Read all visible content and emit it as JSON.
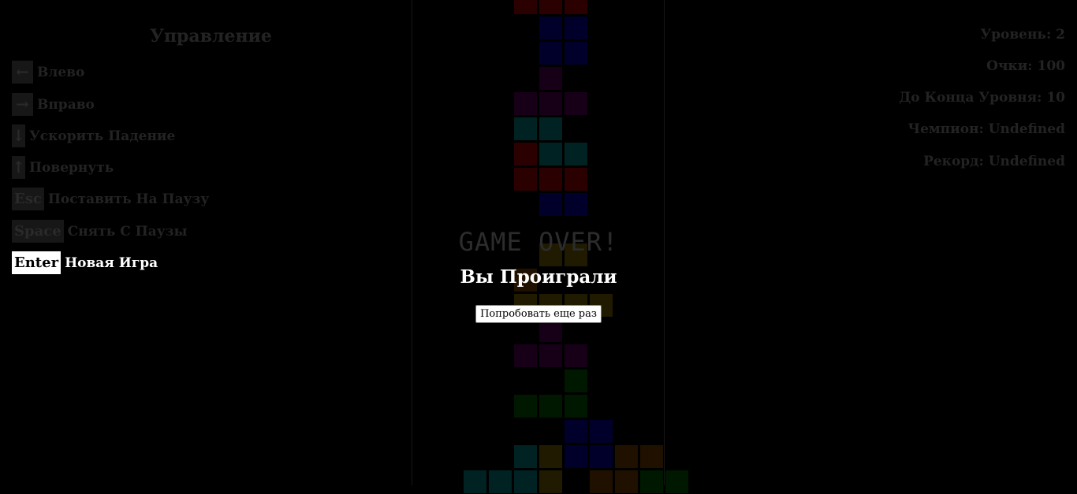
{
  "controls": {
    "title": "Управление",
    "items": [
      {
        "key": "←",
        "label": "Влево"
      },
      {
        "key": "→",
        "label": "Вправо"
      },
      {
        "key": "↓",
        "label": "Ускорить Падение"
      },
      {
        "key": "↑",
        "label": "Повернуть"
      },
      {
        "key": "Esc",
        "label": "Поставить На Паузу"
      },
      {
        "key": "Space",
        "label": "Снять С Паузы"
      },
      {
        "key": "Enter",
        "label": "Новая Игра"
      }
    ]
  },
  "stats": {
    "level": "Уровень: 2",
    "score": "Очки: 100",
    "to_level_end": "До Конца Уровня: 10",
    "champion": "Чемпион: Undefined",
    "record": "Рекорд: Undefined"
  },
  "overlay": {
    "game_over": "GAME OVER!",
    "message": "Вы Проиграли",
    "retry_button": "Попробовать еще раз"
  },
  "colors": {
    "red": "#2a0000",
    "blue": "#00002a",
    "purple": "#170017",
    "cyan": "#002222",
    "yellow": "#1f1a00",
    "green": "#001800",
    "orange": "#1f1000"
  },
  "board": {
    "cols": 10,
    "cells": [
      {
        "col": 3,
        "row": -1,
        "color": "red"
      },
      {
        "col": 4,
        "row": -1,
        "color": "red"
      },
      {
        "col": 5,
        "row": -1,
        "color": "red"
      },
      {
        "col": 4,
        "row": 0,
        "color": "blue"
      },
      {
        "col": 5,
        "row": 0,
        "color": "blue"
      },
      {
        "col": 4,
        "row": 1,
        "color": "blue"
      },
      {
        "col": 5,
        "row": 1,
        "color": "blue"
      },
      {
        "col": 4,
        "row": 2,
        "color": "purple"
      },
      {
        "col": 3,
        "row": 3,
        "color": "purple"
      },
      {
        "col": 4,
        "row": 3,
        "color": "purple"
      },
      {
        "col": 5,
        "row": 3,
        "color": "purple"
      },
      {
        "col": 3,
        "row": 4,
        "color": "cyan"
      },
      {
        "col": 4,
        "row": 4,
        "color": "cyan"
      },
      {
        "col": 3,
        "row": 5,
        "color": "red"
      },
      {
        "col": 4,
        "row": 5,
        "color": "cyan"
      },
      {
        "col": 5,
        "row": 5,
        "color": "cyan"
      },
      {
        "col": 3,
        "row": 6,
        "color": "red"
      },
      {
        "col": 4,
        "row": 6,
        "color": "red"
      },
      {
        "col": 5,
        "row": 6,
        "color": "red"
      },
      {
        "col": 4,
        "row": 7,
        "color": "blue"
      },
      {
        "col": 5,
        "row": 7,
        "color": "blue"
      },
      {
        "col": 4,
        "row": 9,
        "color": "yellow"
      },
      {
        "col": 5,
        "row": 9,
        "color": "yellow"
      },
      {
        "col": 3,
        "row": 10,
        "color": "orange"
      },
      {
        "col": 3,
        "row": 11,
        "color": "yellow"
      },
      {
        "col": 4,
        "row": 11,
        "color": "yellow"
      },
      {
        "col": 5,
        "row": 11,
        "color": "yellow"
      },
      {
        "col": 6,
        "row": 11,
        "color": "yellow"
      },
      {
        "col": 4,
        "row": 12,
        "color": "purple"
      },
      {
        "col": 3,
        "row": 13,
        "color": "purple"
      },
      {
        "col": 4,
        "row": 13,
        "color": "purple"
      },
      {
        "col": 5,
        "row": 13,
        "color": "purple"
      },
      {
        "col": 5,
        "row": 14,
        "color": "green"
      },
      {
        "col": 3,
        "row": 15,
        "color": "green"
      },
      {
        "col": 4,
        "row": 15,
        "color": "green"
      },
      {
        "col": 5,
        "row": 15,
        "color": "green"
      },
      {
        "col": 5,
        "row": 16,
        "color": "blue"
      },
      {
        "col": 6,
        "row": 16,
        "color": "blue"
      },
      {
        "col": 3,
        "row": 17,
        "color": "cyan"
      },
      {
        "col": 4,
        "row": 17,
        "color": "yellow"
      },
      {
        "col": 5,
        "row": 17,
        "color": "blue"
      },
      {
        "col": 6,
        "row": 17,
        "color": "blue"
      },
      {
        "col": 7,
        "row": 17,
        "color": "orange"
      },
      {
        "col": 8,
        "row": 17,
        "color": "orange"
      },
      {
        "col": 1,
        "row": 18,
        "color": "cyan"
      },
      {
        "col": 2,
        "row": 18,
        "color": "cyan"
      },
      {
        "col": 3,
        "row": 18,
        "color": "cyan"
      },
      {
        "col": 4,
        "row": 18,
        "color": "yellow"
      },
      {
        "col": 6,
        "row": 18,
        "color": "orange"
      },
      {
        "col": 7,
        "row": 18,
        "color": "orange"
      },
      {
        "col": 8,
        "row": 18,
        "color": "green"
      },
      {
        "col": 9,
        "row": 18,
        "color": "green"
      }
    ]
  }
}
